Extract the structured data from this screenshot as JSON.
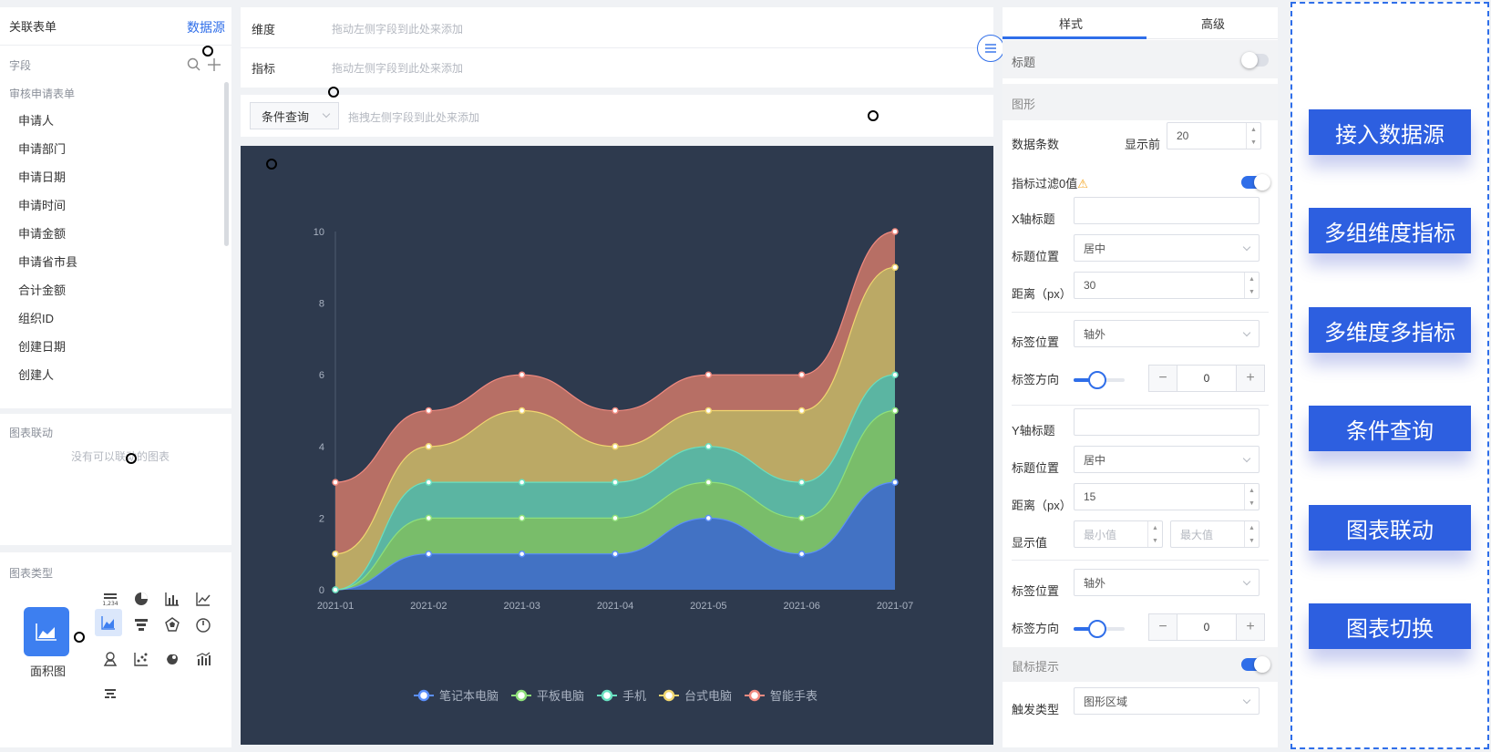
{
  "left": {
    "header_title": "关联表单",
    "header_link": "数据源",
    "fields_label": "字段",
    "form_name": "审核申请表单",
    "fields": [
      "申请人",
      "申请部门",
      "申请日期",
      "申请时间",
      "申请金额",
      "申请省市县",
      "合计金额",
      "组织ID",
      "创建日期",
      "创建人"
    ],
    "link_title": "图表联动",
    "link_empty": "没有可以联动的图表",
    "types_title": "图表类型",
    "selected_type": "面积图"
  },
  "middle": {
    "dimension_label": "维度",
    "dimension_hint": "拖动左侧字段到此处来添加",
    "metric_label": "指标",
    "metric_hint": "拖动左侧字段到此处来添加",
    "filter_select": "条件查询",
    "filter_hint": "拖拽左侧字段到此处来添加"
  },
  "chart_data": {
    "type": "area",
    "stacked": true,
    "smooth": true,
    "categories": [
      "2021-01",
      "2021-02",
      "2021-03",
      "2021-04",
      "2021-05",
      "2021-06",
      "2021-07"
    ],
    "ylim": [
      0,
      10
    ],
    "yticks": [
      "0",
      "2",
      "4",
      "6",
      "8",
      "10"
    ],
    "legend_position": "bottom-center",
    "series": [
      {
        "name": "笔记本电脑",
        "color": "#4272c4",
        "line": "#5b8ff9",
        "values": [
          0,
          1,
          1,
          1,
          2,
          1,
          3
        ]
      },
      {
        "name": "平板电脑",
        "color": "#79bd6a",
        "line": "#8fe07a",
        "values": [
          0,
          1,
          1,
          1,
          1,
          1,
          2
        ]
      },
      {
        "name": "手机",
        "color": "#5bb5a2",
        "line": "#69e0c0",
        "values": [
          0,
          1,
          1,
          1,
          1,
          1,
          1
        ]
      },
      {
        "name": "台式电脑",
        "color": "#bba965",
        "line": "#f0d670",
        "values": [
          1,
          1,
          2,
          1,
          1,
          2,
          3
        ]
      },
      {
        "name": "智能手表",
        "color": "#b76f65",
        "line": "#f08a80",
        "values": [
          2,
          1,
          1,
          1,
          1,
          1,
          1
        ]
      }
    ]
  },
  "right": {
    "tab_style": "样式",
    "tab_advanced": "高级",
    "title_label": "标题",
    "shape_section": "图形",
    "data_count_label": "数据条数",
    "show_top_label": "显示前",
    "show_top_value": "20",
    "filter_zero_label": "指标过滤0值",
    "x_title_label": "X轴标题",
    "x_title_pos_label": "标题位置",
    "x_title_pos_value": "居中",
    "x_distance_label": "距离（px）",
    "x_distance_value": "30",
    "x_tag_pos_label": "标签位置",
    "x_tag_pos_value": "轴外",
    "x_tag_dir_label": "标签方向",
    "x_tag_dir_value": "0",
    "y_title_label": "Y轴标题",
    "y_title_pos_label": "标题位置",
    "y_title_pos_value": "居中",
    "y_distance_label": "距离（px）",
    "y_distance_value": "15",
    "show_value_label": "显示值",
    "min_placeholder": "最小值",
    "max_placeholder": "最大值",
    "y_tag_pos_label": "标签位置",
    "y_tag_pos_value": "轴外",
    "y_tag_dir_label": "标签方向",
    "y_tag_dir_value": "0",
    "tooltip_section": "鼠标提示",
    "trigger_label": "触发类型",
    "trigger_value": "图形区域",
    "minus": "−",
    "plus": "+"
  },
  "features": [
    "接入数据源",
    "多组维度指标",
    "多维度多指标",
    "条件查询",
    "图表联动",
    "图表切换"
  ],
  "colors": {
    "accent": "#2f6ee9",
    "chart_bg": "#2e3a4e",
    "feature_bg": "#2d5fe0"
  }
}
